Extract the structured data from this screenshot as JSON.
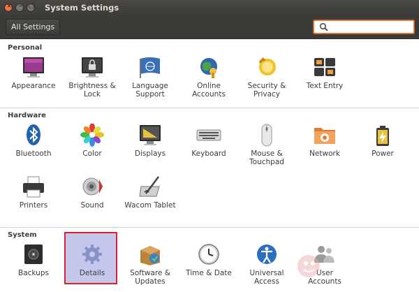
{
  "window": {
    "title": "System Settings"
  },
  "toolbar": {
    "all_settings_label": "All Settings",
    "search_value": ""
  },
  "sections": {
    "personal": {
      "title": "Personal"
    },
    "hardware": {
      "title": "Hardware"
    },
    "system": {
      "title": "System"
    }
  },
  "personal_items": [
    "Appearance",
    "Brightness &\nLock",
    "Language\nSupport",
    "Online\nAccounts",
    "Security &\nPrivacy",
    "Text Entry"
  ],
  "hardware_items": [
    "Bluetooth",
    "Color",
    "Displays",
    "Keyboard",
    "Mouse &\nTouchpad",
    "Network",
    "Power",
    "Printers",
    "Sound",
    "Wacom Tablet"
  ],
  "system_items": [
    "Backups",
    "Details",
    "Software &\nUpdates",
    "Time & Date",
    "Universal\nAccess",
    "User\nAccounts"
  ],
  "selected_item": "Details",
  "colors": {
    "titlebar": "#3c3b37",
    "accent": "#e07b3a",
    "selection_bg": "#c5c8ec",
    "selection_border": "#e0202a"
  }
}
